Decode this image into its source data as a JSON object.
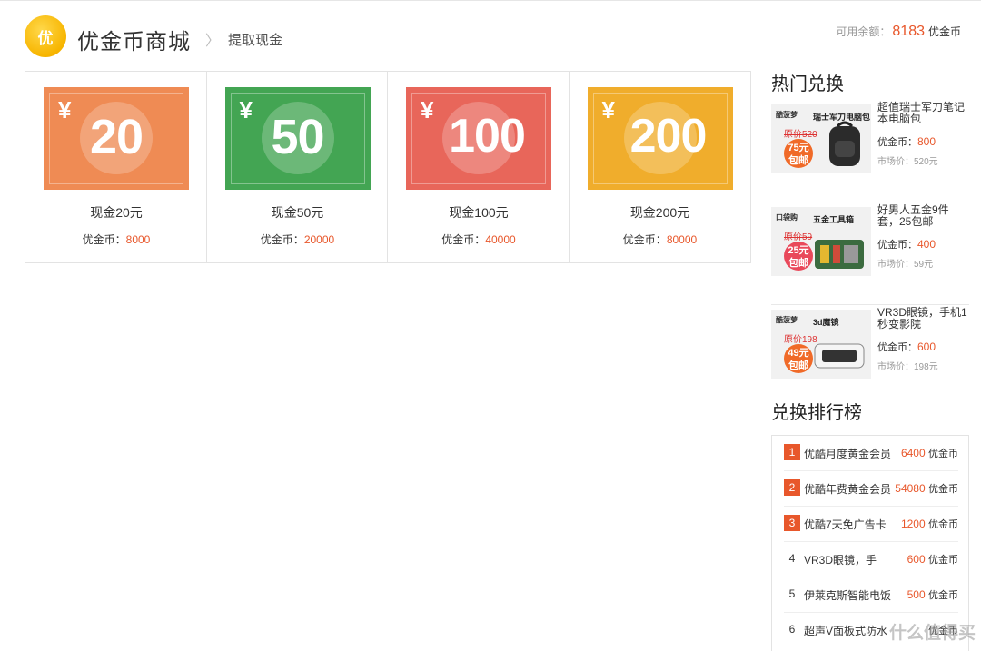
{
  "header": {
    "logo_text": "优",
    "brand": "优金币商城",
    "breadcrumb": "提取现金",
    "balance_label": "可用余额：",
    "balance_value": "8183",
    "balance_unit": "优金币"
  },
  "cash_items": [
    {
      "amount": "20",
      "title": "现金20元",
      "price_label": "优金币：",
      "price": "8000",
      "color": "#ef8b54"
    },
    {
      "amount": "50",
      "title": "现金50元",
      "price_label": "优金币：",
      "price": "20000",
      "color": "#43a553"
    },
    {
      "amount": "100",
      "title": "现金100元",
      "price_label": "优金币：",
      "price": "40000",
      "color": "#e8665a"
    },
    {
      "amount": "200",
      "title": "现金200元",
      "price_label": "优金币：",
      "price": "80000",
      "color": "#f0ad2c"
    }
  ],
  "ticket_symbol": "¥",
  "hot": {
    "heading": "热门兑换",
    "items": [
      {
        "name": "超值瑞士军刀笔记本电脑包",
        "coin_label": "优金币：",
        "coin": "800",
        "market": "市场价：520元",
        "thumb_brand": "酷菠萝",
        "thumb_title": "瑞士军刀电脑包",
        "thumb_orig": "原价520",
        "thumb_badge_top": "75元",
        "thumb_badge_bottom": "包邮",
        "product_icon": "backpack-icon"
      },
      {
        "name": "好男人五金9件套，25包邮",
        "coin_label": "优金币：",
        "coin": "400",
        "market": "市场价：59元",
        "thumb_brand": "口袋购",
        "thumb_title": "五金工具箱",
        "thumb_orig": "原价59",
        "thumb_badge_top": "25元",
        "thumb_badge_bottom": "包邮",
        "product_icon": "toolbox-icon"
      },
      {
        "name": "VR3D眼镜，手机1秒变影院",
        "coin_label": "优金币：",
        "coin": "600",
        "market": "市场价：198元",
        "thumb_brand": "酷菠萝",
        "thumb_title": "3d魔镜",
        "thumb_orig": "原价198",
        "thumb_badge_top": "49元",
        "thumb_badge_bottom": "包邮",
        "product_icon": "vr-headset-icon"
      }
    ]
  },
  "ranking": {
    "heading": "兑换排行榜",
    "items": [
      {
        "rank": "1",
        "name": "优酷月度黄金会员",
        "value": "6400",
        "unit": "优金币"
      },
      {
        "rank": "2",
        "name": "优酷年费黄金会员",
        "value": "54080",
        "unit": "优金币"
      },
      {
        "rank": "3",
        "name": "优酷7天免广告卡",
        "value": "1200",
        "unit": "优金币"
      },
      {
        "rank": "4",
        "name": "VR3D眼镜，手",
        "value": "600",
        "unit": "优金币"
      },
      {
        "rank": "5",
        "name": "伊莱克斯智能电饭",
        "value": "500",
        "unit": "优金币"
      },
      {
        "rank": "6",
        "name": "超声V面板式防水",
        "value": "",
        "unit": "优金币"
      }
    ]
  },
  "watermark": "什么值得买"
}
